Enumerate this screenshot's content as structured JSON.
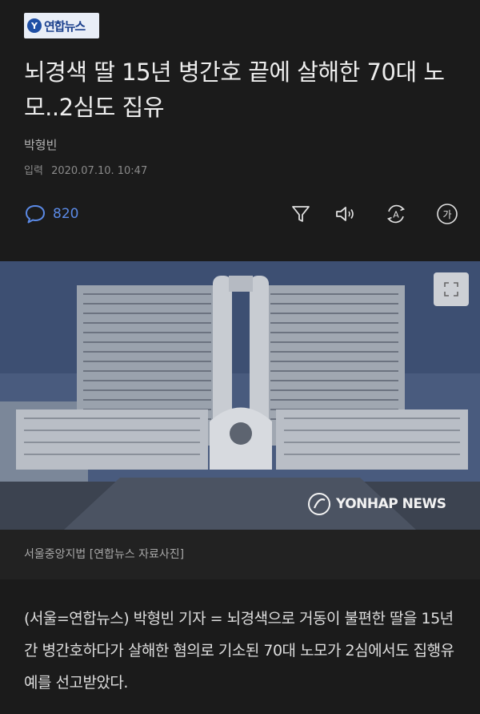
{
  "logo": {
    "text": "연합뉴스",
    "mark": "Y"
  },
  "article": {
    "title": "뇌경색 딸 15년 병간호 끝에 살해한 70대 노모..2심도 집유",
    "reporter": "박형빈",
    "date_label": "입력",
    "date_value": "2020.07.10. 10:47",
    "body": "(서울=연합뉴스) 박형빈 기자 = 뇌경색으로 거동이 불편한 딸을 15년간 병간호하다가 살해한 혐의로 기소된 70대 노모가 2심에서도 집행유예를 선고받았다."
  },
  "toolbar": {
    "comment_count": "820",
    "icons": [
      "comment-icon",
      "filter-icon",
      "speaker-icon",
      "auto-translate-icon",
      "font-size-icon"
    ],
    "font_size_label": "가",
    "translate_label": "A"
  },
  "photo": {
    "watermark_text": "YONHAP NEWS",
    "caption": "서울중앙지법 [연합뉴스 자료사진]"
  },
  "colors": {
    "accent": "#5b8ae6",
    "background": "#1b1b1b"
  }
}
